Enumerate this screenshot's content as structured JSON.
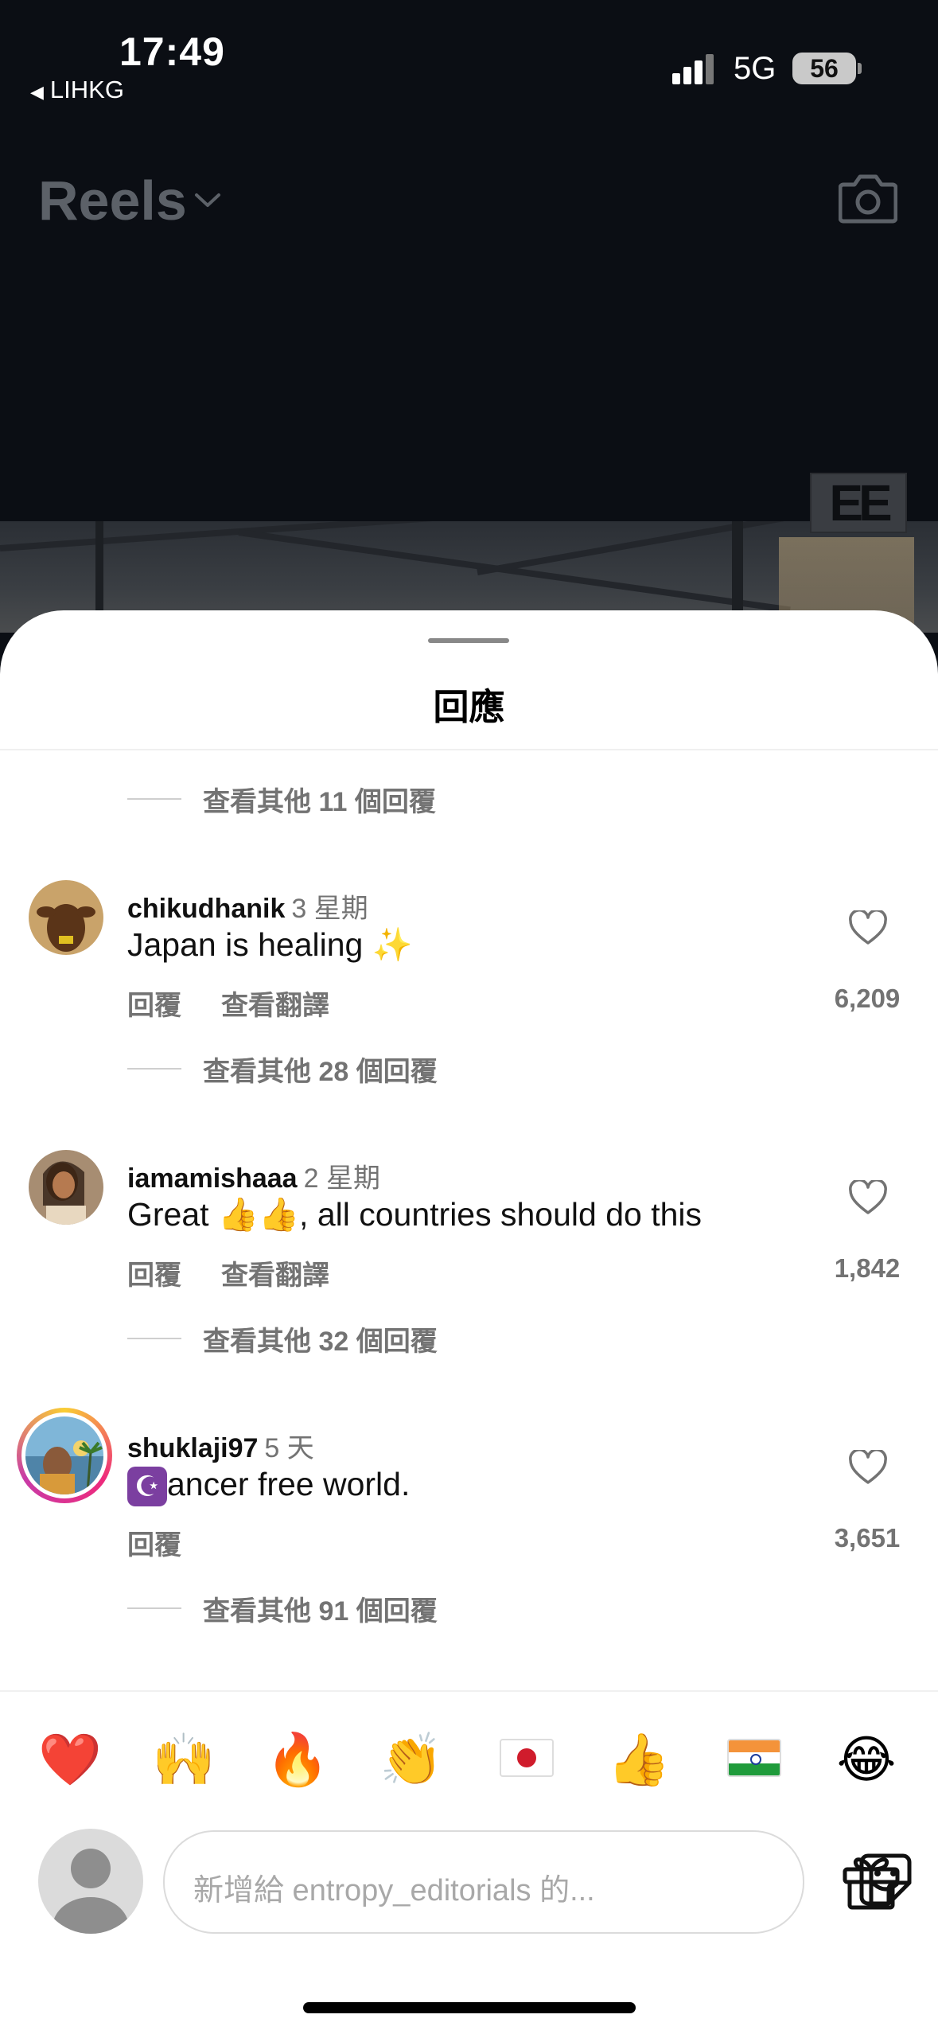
{
  "status_bar": {
    "time": "17:49",
    "back_app": "LIHKG",
    "network": "5G",
    "battery": "56"
  },
  "header": {
    "title": "Reels",
    "watermark": "EE"
  },
  "sheet": {
    "title": "回應"
  },
  "comments": [
    {
      "view_more": "查看其他 11 個回覆"
    },
    {
      "username": "chikudhanik",
      "time": "3 星期",
      "text": "Japan is healing ✨",
      "actions": [
        "回覆",
        "查看翻譯"
      ],
      "likes": "6,209",
      "view_more": "查看其他 28 個回覆"
    },
    {
      "username": "iamamishaaa",
      "time": "2 星期",
      "text_before": "Great ",
      "text_emoji": "👍👍",
      "text_after": ", all countries should do this",
      "actions": [
        "回覆",
        "查看翻譯"
      ],
      "likes": "1,842",
      "view_more": "查看其他 32 個回覆"
    },
    {
      "username": "shuklaji97",
      "time": "5 天",
      "text_icon": "☪",
      "text": "ancer free world.",
      "actions": [
        "回覆"
      ],
      "likes": "3,651",
      "view_more": "查看其他 91 個回覆"
    }
  ],
  "emoji_bar": [
    {
      "name": "heart",
      "char": "❤️"
    },
    {
      "name": "raised-hands",
      "char": "🙌"
    },
    {
      "name": "fire",
      "char": "🔥"
    },
    {
      "name": "clapping-hands",
      "char": "👏"
    },
    {
      "name": "flag-japan",
      "char": "🇯🇵"
    },
    {
      "name": "thumbs-up",
      "char": "👍"
    },
    {
      "name": "flag-india",
      "char": "🇮🇳"
    },
    {
      "name": "tears-of-joy",
      "char": "😂"
    }
  ],
  "input": {
    "placeholder": "新增給 entropy_editorials 的..."
  },
  "colors": {
    "top_bg": "#0b0e14",
    "sheet_bg": "#ffffff",
    "muted_text": "#737373",
    "primary_text": "#111111"
  }
}
